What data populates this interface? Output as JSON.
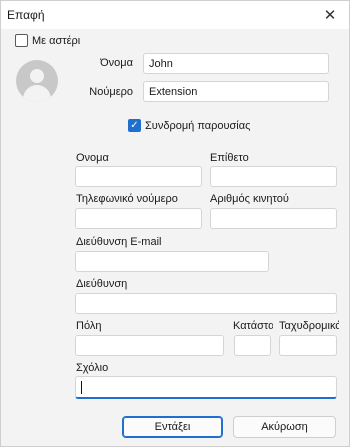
{
  "window": {
    "title": "Επαφή"
  },
  "starred": {
    "label": "Με αστέρι",
    "checked": false
  },
  "header": {
    "name_label": "Όνομα",
    "name_value": "John",
    "number_label": "Νούμερο",
    "number_value": "Extension"
  },
  "presence": {
    "label": "Συνδρομή παρουσίας",
    "checked": true
  },
  "form": {
    "first_name_label": "Ονομα",
    "last_name_label": "Επίθετο",
    "phone_label": "Τηλεφωνικό νούμερο",
    "mobile_label": "Αριθμός κινητού",
    "email_label": "Διεύθυνση E-mail",
    "address_label": "Διεύθυνση",
    "city_label": "Πόλη",
    "state_label": "Κατάστα",
    "zip_label": "Ταχυδρομικό",
    "comment_label": "Σχόλιο"
  },
  "buttons": {
    "ok": "Εντάξει",
    "cancel": "Ακύρωση"
  },
  "icons": {
    "close": "close-icon",
    "avatar": "contact-avatar-icon",
    "check": "check-icon"
  },
  "colors": {
    "accent": "#1f6fd1",
    "background": "#f3f3f3"
  }
}
